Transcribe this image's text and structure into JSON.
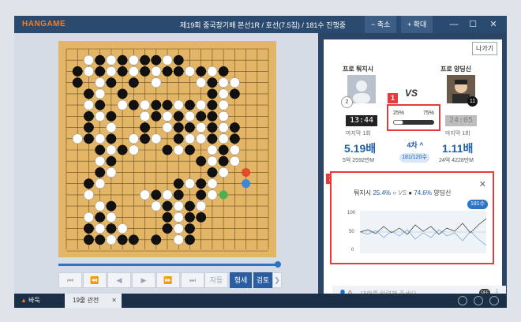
{
  "window": {
    "brand": "HANGAME",
    "title": "제19회 중국창기배 본선1R  / 호선(7.5집) / 181수 진행중",
    "zoom_out": "−  축소",
    "zoom_in": "+  확대",
    "minimize": "—",
    "maximize": "☐",
    "close": "✕"
  },
  "controls": {
    "first": "⏮",
    "prev10": "⏪",
    "prev": "◀",
    "next": "▶",
    "next10": "⏩",
    "last": "⏭",
    "auto": "자동",
    "status": "형세",
    "review": "검토",
    "more": "❯"
  },
  "side": {
    "exit": "나가기",
    "vs": "VS",
    "left": {
      "name": "프로 퉈지시",
      "stone": "2",
      "clock": "13:44",
      "last": "마지막 1회",
      "odds": "5.19배",
      "prize": "5억 2592만M"
    },
    "right": {
      "name": "프로 양딩신",
      "stone": "11",
      "clock": "24:05",
      "last": "마지막 1회",
      "odds": "1.11배",
      "prize": "24억 4228만M"
    },
    "round": "4차 ^",
    "round_sub": "181/120수",
    "winrate": {
      "left": "25%",
      "right": "75%",
      "value": 0.25
    },
    "badges": {
      "one": "1",
      "two": "2"
    }
  },
  "popup": {
    "left_label": "퉈지시",
    "left_pct": "25.4%",
    "vs": "VS",
    "right_pct": "74.6%",
    "right_label": "양딩신",
    "move_tag": "181수",
    "y_labels": [
      "100",
      "50",
      "0"
    ],
    "close": "✕"
  },
  "chat": {
    "count": "0",
    "placeholder": "대화를 입력해 주세요.",
    "toggle": "OFF"
  },
  "taskbar": {
    "home": "바둑",
    "tab": "19줄 관전",
    "tab_close": "✕"
  }
}
